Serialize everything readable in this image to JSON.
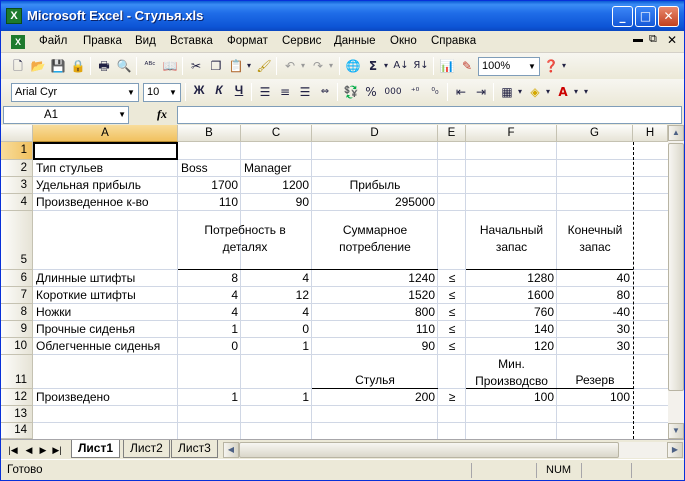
{
  "window": {
    "title": "Microsoft Excel - Стулья.xls",
    "icon": "excel-icon"
  },
  "menu": [
    "Файл",
    "Правка",
    "Вид",
    "Вставка",
    "Формат",
    "Сервис",
    "Данные",
    "Окно",
    "Справка"
  ],
  "toolbar": {
    "zoom": "100%"
  },
  "format_toolbar": {
    "font": "Arial Cyr",
    "size": "10",
    "bold": "Ж",
    "italic": "К",
    "underline": "Ч"
  },
  "formula_bar": {
    "cell_ref": "A1",
    "fx": "fx",
    "value": ""
  },
  "columns": [
    "A",
    "B",
    "C",
    "D",
    "E",
    "F",
    "G",
    "H"
  ],
  "rows": [
    "1",
    "2",
    "3",
    "4",
    "5",
    "6",
    "7",
    "8",
    "9",
    "10",
    "11",
    "12",
    "13",
    "14"
  ],
  "cells": {
    "A2": "Тип стульев",
    "B2": "Boss",
    "C2": "Manager",
    "A3": "Удельная прибыль",
    "B3": "1700",
    "C3": "1200",
    "D3": "Прибыль",
    "A4": "Произведенное к-во",
    "B4": "110",
    "C4": "90",
    "D4": "295000",
    "B5": "Потребность в деталях",
    "D5": "Суммарное потребление",
    "F5": "Начальный запас",
    "G5": "Конечный запас",
    "A6": "Длинные штифты",
    "B6": "8",
    "C6": "4",
    "D6": "1240",
    "E6": "≤",
    "F6": "1280",
    "G6": "40",
    "A7": "Короткие штифты",
    "B7": "4",
    "C7": "12",
    "D7": "1520",
    "E7": "≤",
    "F7": "1600",
    "G7": "80",
    "A8": "Ножки",
    "B8": "4",
    "C8": "4",
    "D8": "800",
    "E8": "≤",
    "F8": "760",
    "G8": "-40",
    "A9": "Прочные сиденья",
    "B9": "1",
    "C9": "0",
    "D9": "110",
    "E9": "≤",
    "F9": "140",
    "G9": "30",
    "A10": "Облегченные сиденья",
    "B10": "0",
    "C10": "1",
    "D10": "90",
    "E10": "≤",
    "F10": "120",
    "G10": "30",
    "D11": "Стулья",
    "F11": "Мин. Производсво",
    "G11": "Резерв",
    "A12": "Произведено",
    "B12": "1",
    "C12": "1",
    "D12": "200",
    "E12": "≥",
    "F12": "100",
    "G12": "100"
  },
  "sheet_tabs": [
    "Лист1",
    "Лист2",
    "Лист3"
  ],
  "active_tab": "Лист1",
  "status": {
    "text": "Готово",
    "num": "NUM"
  }
}
